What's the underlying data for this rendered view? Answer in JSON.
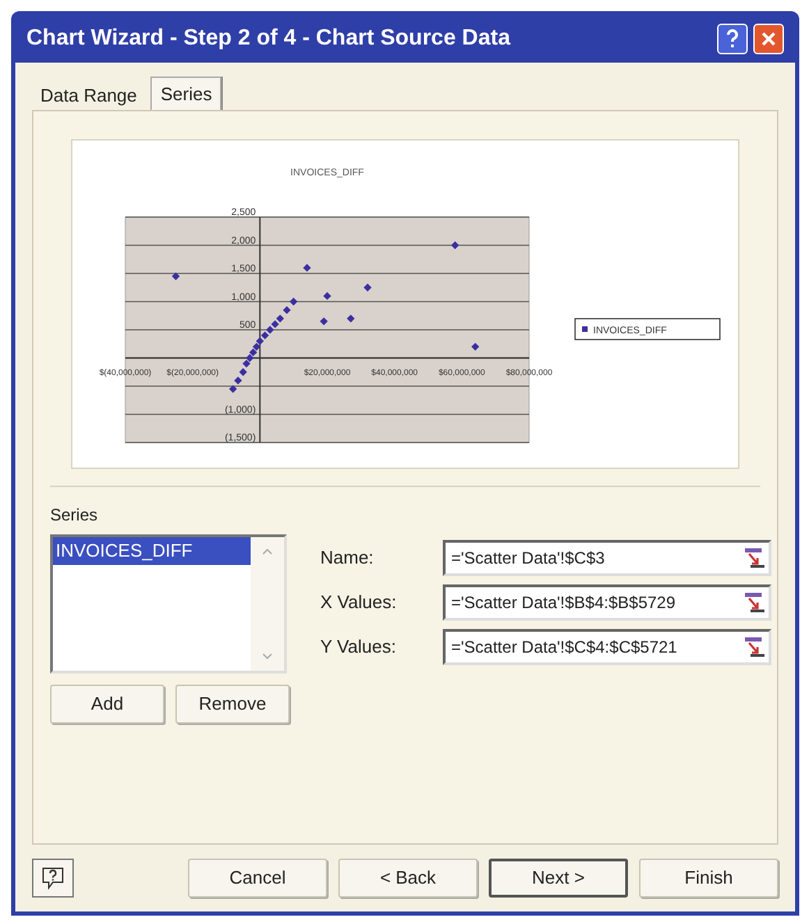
{
  "window": {
    "title": "Chart Wizard - Step 2 of 4 - Chart Source Data"
  },
  "tabs": [
    {
      "label": "Data Range",
      "selected": false
    },
    {
      "label": "Series",
      "selected": true
    }
  ],
  "preview": {
    "chart_data": {
      "type": "scatter",
      "title": "INVOICES_DIFF",
      "x": [
        -25000000,
        -8000000,
        -6500000,
        -5000000,
        -4000000,
        -3000000,
        -2000000,
        -1000000,
        0,
        1500000,
        3000000,
        4500000,
        6000000,
        8000000,
        10000000,
        14000000,
        20000000,
        32000000,
        19000000,
        27000000,
        58000000,
        64000000
      ],
      "series": [
        {
          "name": "INVOICES_DIFF",
          "color": "#3b2fa0",
          "values": [
            1450,
            -550,
            -400,
            -250,
            -100,
            0,
            100,
            200,
            300,
            400,
            500,
            600,
            700,
            850,
            1000,
            1600,
            1100,
            1250,
            650,
            700,
            2000,
            200
          ]
        }
      ],
      "grid": true,
      "xlim": [
        -40000000,
        80000000
      ],
      "ylim": [
        -1500,
        2500
      ],
      "xticks": [
        {
          "value": -40000000,
          "label": "$(40,000,000)"
        },
        {
          "value": -20000000,
          "label": "$(20,000,000)"
        },
        {
          "value": 20000000,
          "label": "$20,000,000"
        },
        {
          "value": 40000000,
          "label": "$40,000,000"
        },
        {
          "value": 60000000,
          "label": "$60,000,000"
        },
        {
          "value": 80000000,
          "label": "$80,000,000"
        }
      ],
      "yticks": [
        {
          "value": 2500,
          "label": "2,500"
        },
        {
          "value": 2000,
          "label": "2,000"
        },
        {
          "value": 1500,
          "label": "1,500"
        },
        {
          "value": 1000,
          "label": "1,000"
        },
        {
          "value": 500,
          "label": "500"
        },
        {
          "value": -1000,
          "label": "(1,000)"
        },
        {
          "value": -1500,
          "label": "(1,500)"
        }
      ]
    }
  },
  "series_panel": {
    "label": "Series",
    "items": [
      {
        "label": "INVOICES_DIFF",
        "selected": true
      }
    ],
    "buttons": [
      "Add",
      "Remove"
    ]
  },
  "fields": [
    {
      "label": "Name:",
      "value": "='Scatter Data'!$C$3"
    },
    {
      "label": "X Values:",
      "value": "='Scatter Data'!$B$4:$B$5729"
    },
    {
      "label": "Y Values:",
      "value": "='Scatter Data'!$C$4:$C$5721"
    }
  ],
  "footer": {
    "buttons": [
      {
        "label": "Cancel",
        "default": false
      },
      {
        "label": "< Back",
        "default": false
      },
      {
        "label": "Next >",
        "default": true
      },
      {
        "label": "Finish",
        "default": false
      }
    ]
  }
}
